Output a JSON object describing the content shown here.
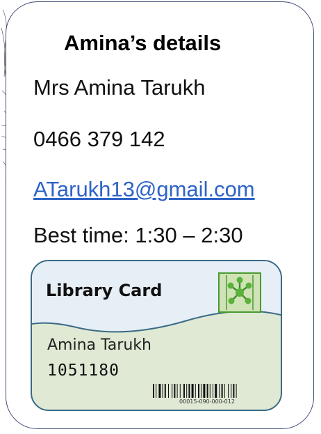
{
  "details": {
    "heading": "Amina’s details",
    "name": "Mrs Amina Tarukh",
    "phone": "0466 379 142",
    "email": "ATarukh13@gmail.com",
    "best_time": "Best time: 1:30 – 2:30"
  },
  "library_card": {
    "title": "Library Card",
    "holder_name": "Amina Tarukh",
    "card_number": "1051180",
    "barcode_number": "00015-090-000-012",
    "colors": {
      "background": "#dfe9d4",
      "border": "#3a6a86",
      "logo": "#5ab23a"
    }
  },
  "colors": {
    "card_border": "#3b4a75",
    "link": "#2e63c7"
  },
  "icons": [
    "network-logo-icon",
    "barcode-icon"
  ]
}
